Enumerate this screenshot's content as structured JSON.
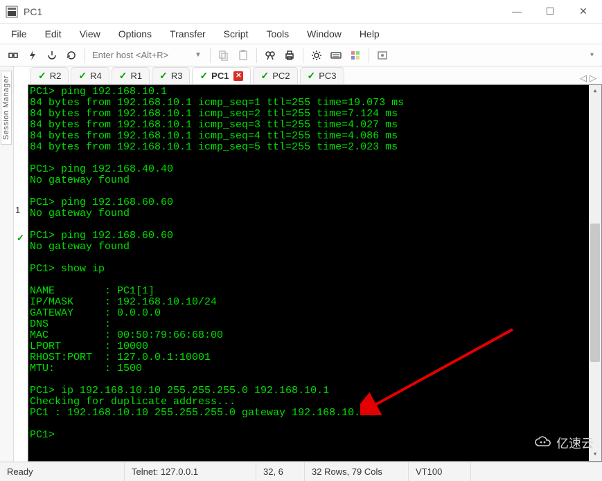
{
  "window": {
    "title": "PC1"
  },
  "menu": {
    "items": [
      "File",
      "Edit",
      "View",
      "Options",
      "Transfer",
      "Script",
      "Tools",
      "Window",
      "Help"
    ]
  },
  "toolbar": {
    "host_placeholder": "Enter host <Alt+R>"
  },
  "sidebar": {
    "label": "Session Manager"
  },
  "gutter": {
    "num": "1"
  },
  "tabs": [
    {
      "label": "R2",
      "active": false,
      "closable": false
    },
    {
      "label": "R4",
      "active": false,
      "closable": false
    },
    {
      "label": "R1",
      "active": false,
      "closable": false
    },
    {
      "label": "R3",
      "active": false,
      "closable": false
    },
    {
      "label": "PC1",
      "active": true,
      "closable": true
    },
    {
      "label": "PC2",
      "active": false,
      "closable": false
    },
    {
      "label": "PC3",
      "active": false,
      "closable": false
    }
  ],
  "terminal": {
    "lines": [
      "PC1> ping 192.168.10.1",
      "84 bytes from 192.168.10.1 icmp_seq=1 ttl=255 time=19.073 ms",
      "84 bytes from 192.168.10.1 icmp_seq=2 ttl=255 time=7.124 ms",
      "84 bytes from 192.168.10.1 icmp_seq=3 ttl=255 time=4.027 ms",
      "84 bytes from 192.168.10.1 icmp_seq=4 ttl=255 time=4.086 ms",
      "84 bytes from 192.168.10.1 icmp_seq=5 ttl=255 time=2.023 ms",
      "",
      "PC1> ping 192.168.40.40",
      "No gateway found",
      "",
      "PC1> ping 192.168.60.60",
      "No gateway found",
      "",
      "PC1> ping 192.168.60.60",
      "No gateway found",
      "",
      "PC1> show ip",
      "",
      "NAME        : PC1[1]",
      "IP/MASK     : 192.168.10.10/24",
      "GATEWAY     : 0.0.0.0",
      "DNS         :",
      "MAC         : 00:50:79:66:68:00",
      "LPORT       : 10000",
      "RHOST:PORT  : 127.0.0.1:10001",
      "MTU:        : 1500",
      "",
      "PC1> ip 192.168.10.10 255.255.255.0 192.168.10.1",
      "Checking for duplicate address...",
      "PC1 : 192.168.10.10 255.255.255.0 gateway 192.168.10.1",
      "",
      "PC1>"
    ]
  },
  "status": {
    "ready": "Ready",
    "conn": "Telnet: 127.0.0.1",
    "cursor": "32,  6",
    "size": "32 Rows, 79 Cols",
    "term": "VT100"
  },
  "watermark": {
    "text": "亿速云"
  }
}
